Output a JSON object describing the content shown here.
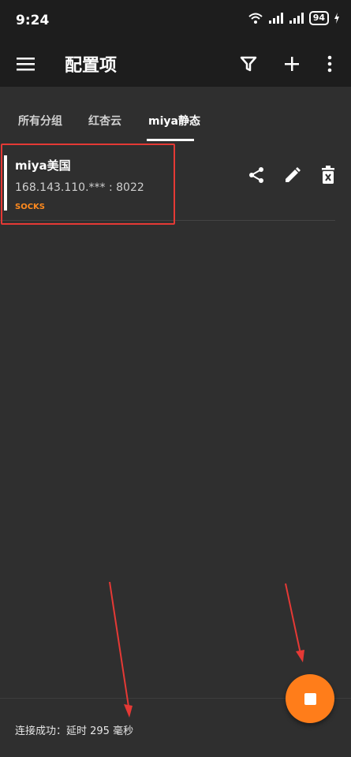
{
  "status_bar": {
    "time": "9:24",
    "battery": "94",
    "icons": [
      "wifi-icon",
      "signal-icon",
      "signal-icon",
      "battery-icon",
      "charging-icon"
    ]
  },
  "app_bar": {
    "title": "配置项",
    "icons": [
      "menu-icon",
      "filter-icon",
      "add-icon",
      "more-vert-icon"
    ]
  },
  "tabs": [
    {
      "label": "所有分组",
      "active": false
    },
    {
      "label": "红杏云",
      "active": false
    },
    {
      "label": "miya静态",
      "active": true
    }
  ],
  "server": {
    "name": "miya美国",
    "address": "168.143.110.*** : 8022",
    "type": "SOCKS",
    "actions": [
      "share-icon",
      "edit-icon",
      "delete-icon"
    ]
  },
  "footer": {
    "status": "连接成功：延时 295 毫秒"
  },
  "colors": {
    "accent": "#ff7d1a",
    "background": "#2f2f2f",
    "toolbar": "#1d1d1d",
    "annotation": "#e53935"
  }
}
